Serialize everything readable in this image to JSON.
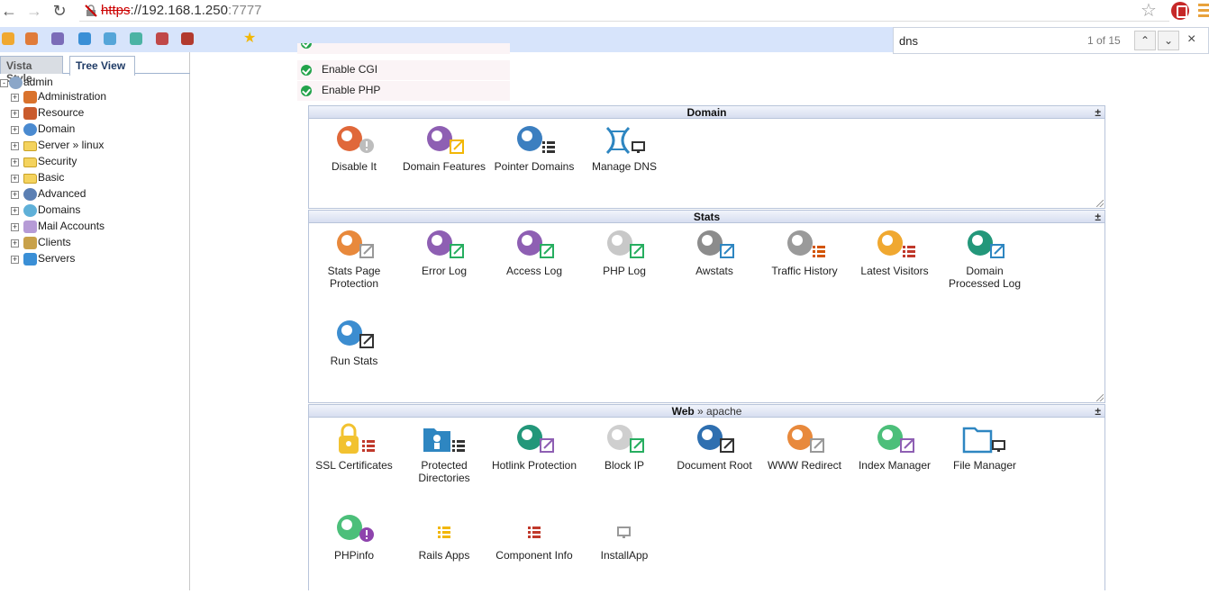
{
  "browser": {
    "url_scheme": "https",
    "url_host": "://192.168.1.250",
    "url_port": ":7777",
    "find": {
      "query": "dns",
      "count": "1 of 15"
    }
  },
  "sidebar": {
    "tabs": [
      {
        "label": "Vista Style"
      },
      {
        "label": "Tree View"
      }
    ],
    "root_label": "admin",
    "items": [
      {
        "label": "Administration"
      },
      {
        "label": "Resource"
      },
      {
        "label": "Domain"
      },
      {
        "label": "Server  »  linux"
      },
      {
        "label": "Security"
      },
      {
        "label": "Basic"
      },
      {
        "label": "Advanced"
      },
      {
        "label": "Domains"
      },
      {
        "label": "Mail Accounts"
      },
      {
        "label": "Clients"
      },
      {
        "label": "Servers"
      }
    ]
  },
  "toggles": [
    {
      "label": "Enable CGI"
    },
    {
      "label": "Enable PHP"
    }
  ],
  "panels": {
    "domain": {
      "title": "Domain",
      "toggle": "±",
      "tiles": [
        {
          "label": "Disable It"
        },
        {
          "label": "Domain Features"
        },
        {
          "label": "Pointer Domains"
        },
        {
          "label": "Manage DNS"
        }
      ]
    },
    "stats": {
      "title": "Stats",
      "toggle": "±",
      "tiles": [
        {
          "label": "Stats Page Protection"
        },
        {
          "label": "Error Log"
        },
        {
          "label": "Access Log"
        },
        {
          "label": "PHP Log"
        },
        {
          "label": "Awstats"
        },
        {
          "label": "Traffic History"
        },
        {
          "label": "Latest Visitors"
        },
        {
          "label": "Domain Processed Log"
        },
        {
          "label": "Run Stats"
        }
      ]
    },
    "web": {
      "title": "Web",
      "subtitle": " » apache",
      "toggle": "±",
      "tiles": [
        {
          "label": "SSL Certificates"
        },
        {
          "label": "Protected Directories"
        },
        {
          "label": "Hotlink Protection"
        },
        {
          "label": "Block IP"
        },
        {
          "label": "Document Root"
        },
        {
          "label": "WWW Redirect"
        },
        {
          "label": "Index Manager"
        },
        {
          "label": "File Manager"
        },
        {
          "label": "PHPinfo"
        },
        {
          "label": "Rails Apps"
        },
        {
          "label": "Component Info"
        },
        {
          "label": "InstallApp"
        }
      ]
    }
  },
  "colors": {
    "bookmark_bar": "#d7e4fb",
    "panel_header": "#d7def0",
    "check_green": "#23a34b"
  }
}
